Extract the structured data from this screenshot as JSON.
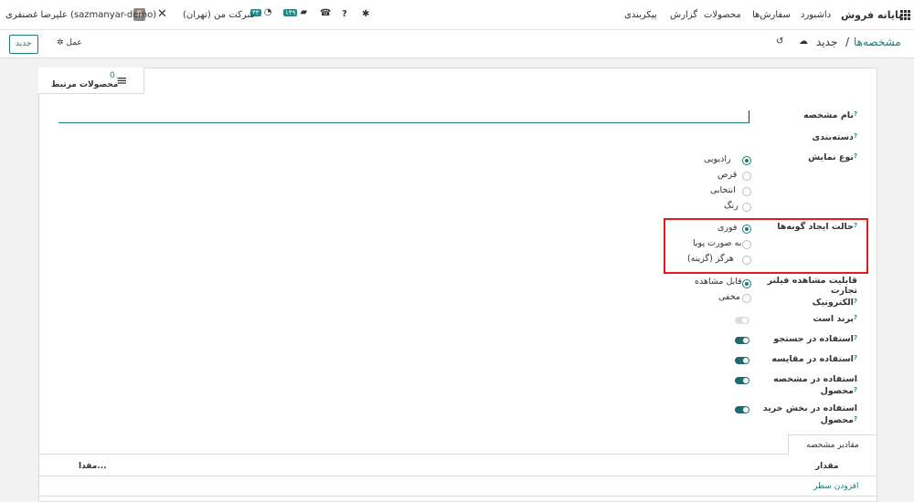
{
  "topbar": {
    "brand": "پایانه فروش",
    "menu": [
      "داشبورد",
      "سفارش‌ها",
      "محصولات",
      "گزارش",
      "پیکربندی"
    ],
    "user": "علیرضا غضنفری (sazmanyar-demo)",
    "company": "شرکت من (تهران)",
    "badge_1": "۴۳",
    "badge_2": "۱۴۹"
  },
  "control": {
    "breadcrumb_parent": "مشخصه‌ها",
    "breadcrumb_sep": "/",
    "breadcrumb_current": "جدید",
    "new_button": "جدید",
    "action": "عمل"
  },
  "smart_button": {
    "count": "0",
    "label": "محصولات مرتبط"
  },
  "form": {
    "name_label": "نام مشخصه",
    "category_label": "دسته‌بندی",
    "display_type": {
      "label": "نوع نمایش",
      "options": [
        "رادیویی",
        "قرص",
        "انتخابی",
        "رنگ"
      ],
      "selected": 0
    },
    "variant_creation": {
      "label": "حالت ایجاد گونه‌ها",
      "options": [
        "فوری",
        "به صورت پویا",
        "هرگز (گزینه)"
      ],
      "selected": 0
    },
    "ecommerce_visibility": {
      "label_line1": "قابلیت مشاهده فیلتر تجارت",
      "label_line2": "الکترونیک",
      "options": [
        "قابل مشاهده",
        "مخفی"
      ],
      "selected": 0
    },
    "toggles": [
      {
        "label": "برند است",
        "label2": "",
        "on": false
      },
      {
        "label": "استفاده در جستجو",
        "label2": "",
        "on": true
      },
      {
        "label": "استفاده در مقایسه",
        "label2": "",
        "on": true
      },
      {
        "label": "استفاده در مشخصه",
        "label2": "محصول",
        "on": true
      },
      {
        "label": "استفاده در بخش خرید",
        "label2": "محصول",
        "on": true
      }
    ],
    "help_mark": "?"
  },
  "values_tab": {
    "tab_label": "مقادیر مشخصه",
    "col_value": "مقدار",
    "col_default": "مقدا...",
    "add_line": "افزودن سطر"
  }
}
